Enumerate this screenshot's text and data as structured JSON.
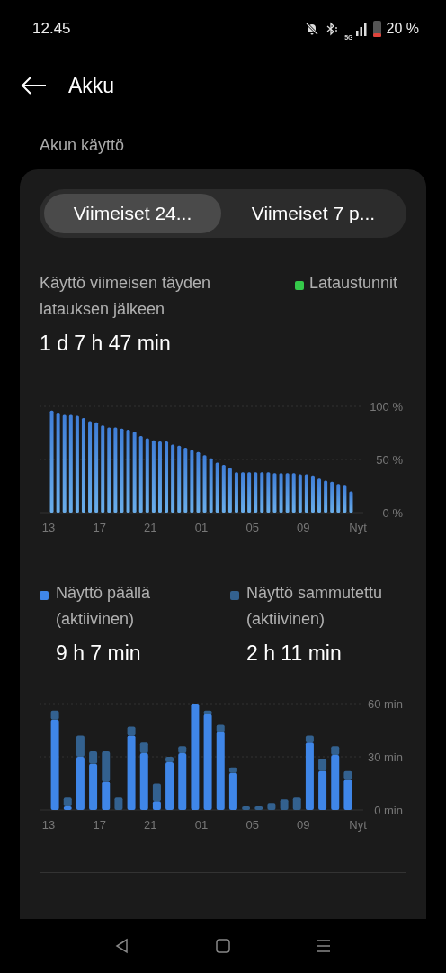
{
  "status_bar": {
    "time": "12.45",
    "network": "5G",
    "battery": "20 %"
  },
  "header": {
    "title": "Akku"
  },
  "section": {
    "title": "Akun käyttö"
  },
  "tabs": [
    {
      "label": "Viimeiset 24...",
      "selected": true
    },
    {
      "label": "Viimeiset 7 p...",
      "selected": false
    }
  ],
  "summary": {
    "label": "Käyttö viimeisen täyden latauksen jälkeen",
    "value": "1 d 7 h 47 min",
    "legend": {
      "label": "Lataustunnit",
      "color": "#35c94a"
    }
  },
  "battery_chart": {
    "end_label": "Nyt",
    "chart_data": {
      "type": "bar",
      "categories": [
        "13",
        null,
        null,
        null,
        null,
        null,
        null,
        null,
        "17",
        null,
        null,
        null,
        null,
        null,
        null,
        null,
        "21",
        null,
        null,
        null,
        null,
        null,
        null,
        null,
        "01",
        null,
        null,
        null,
        null,
        null,
        null,
        null,
        "05",
        null,
        null,
        null,
        null,
        null,
        null,
        null,
        "09",
        null,
        null,
        null,
        null,
        null,
        null,
        null
      ],
      "values": [
        96,
        94,
        92,
        92,
        91,
        89,
        86,
        85,
        82,
        80,
        80,
        79,
        78,
        76,
        72,
        70,
        68,
        67,
        67,
        64,
        63,
        61,
        59,
        57,
        54,
        51,
        47,
        45,
        42,
        38,
        38,
        38,
        38,
        38,
        38,
        37,
        37,
        37,
        37,
        36,
        36,
        35,
        32,
        30,
        29,
        27,
        26,
        20
      ],
      "ylim": [
        0,
        100
      ],
      "yticks": [
        {
          "value": 0,
          "label": "0 %"
        },
        {
          "value": 50,
          "label": "50 %"
        },
        {
          "value": 100,
          "label": "100 %"
        }
      ]
    }
  },
  "screen_legend": [
    {
      "label": "Näyttö päällä (aktiivinen)",
      "value": "9 h 7 min",
      "color": "#3f86e8"
    },
    {
      "label": "Näyttö sammutettu (aktiivinen)",
      "value": "2 h 11 min",
      "color": "#33618f"
    }
  ],
  "screen_chart": {
    "end_label": "Nyt",
    "chart_data": {
      "type": "bar",
      "stacked": true,
      "categories": [
        "13",
        null,
        null,
        null,
        "17",
        null,
        null,
        null,
        "21",
        null,
        null,
        null,
        "01",
        null,
        null,
        null,
        "05",
        null,
        null,
        null,
        "09",
        null,
        null,
        null
      ],
      "series": [
        {
          "color": "#3f86e8",
          "values": [
            51,
            2,
            30,
            26,
            16,
            0,
            42,
            32,
            5,
            27,
            32,
            60,
            54,
            44,
            21,
            0,
            0,
            0,
            0,
            0,
            38,
            22,
            31,
            17
          ]
        },
        {
          "color": "#33618f",
          "values": [
            5,
            5,
            12,
            7,
            17,
            7,
            5,
            6,
            10,
            3,
            4,
            0,
            2,
            4,
            3,
            2,
            2,
            4,
            6,
            7,
            4,
            7,
            5,
            5
          ]
        }
      ],
      "ylim": [
        0,
        60
      ],
      "yticks": [
        {
          "value": 0,
          "label": "0 min"
        },
        {
          "value": 30,
          "label": "30 min"
        },
        {
          "value": 60,
          "label": "60 min"
        }
      ]
    }
  }
}
